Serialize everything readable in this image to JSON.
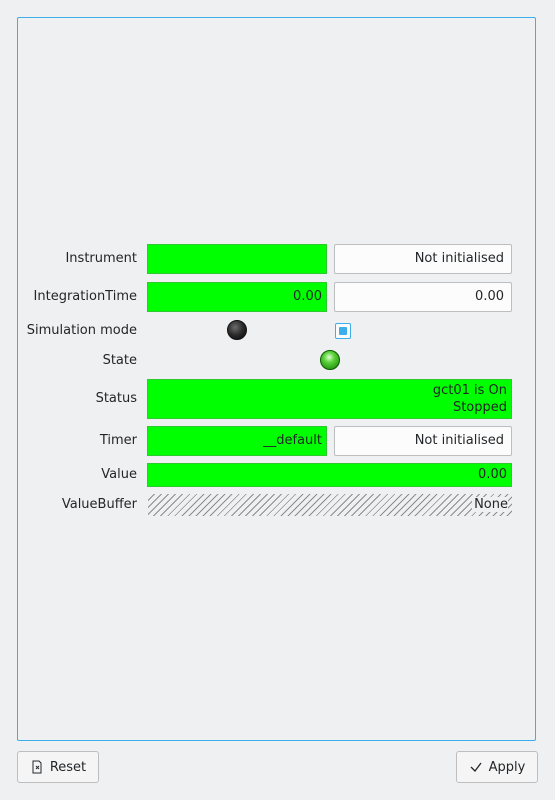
{
  "rows": {
    "instrument": {
      "label": "Instrument",
      "read": "",
      "write": "Not initialised"
    },
    "integration_time": {
      "label": "IntegrationTime",
      "read": "0.00",
      "write": "0.00"
    },
    "simulation_mode": {
      "label": "Simulation mode"
    },
    "state": {
      "label": "State"
    },
    "status": {
      "label": "Status",
      "line1": "gct01 is On",
      "line2": "Stopped"
    },
    "timer": {
      "label": "Timer",
      "read": "__default",
      "write": "Not initialised"
    },
    "value": {
      "label": "Value",
      "read": "0.00"
    },
    "value_buffer": {
      "label": "ValueBuffer",
      "read": "None"
    }
  },
  "buttons": {
    "reset": "Reset",
    "apply": "Apply"
  },
  "icons": {
    "reset": "reset-icon",
    "apply": "checkmark-icon"
  },
  "colors": {
    "valid": "#00ff00",
    "accent": "#3daee9",
    "state_on": "#2fbf1a"
  }
}
